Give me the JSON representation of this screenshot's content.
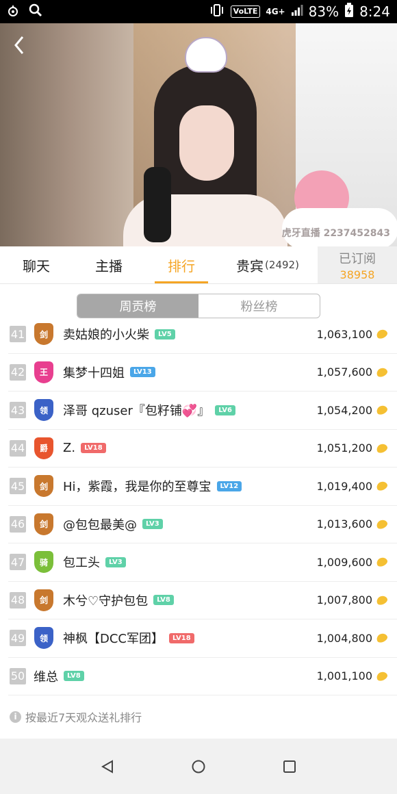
{
  "status_bar": {
    "volte": "VoLTE",
    "network": "4G+",
    "battery": "83%",
    "time": "8:24"
  },
  "video": {
    "watermark": "虎牙直播 2237452843"
  },
  "tabs": [
    {
      "label": "聊天"
    },
    {
      "label": "主播"
    },
    {
      "label": "排行",
      "active": true
    },
    {
      "label": "贵宾",
      "count": "(2492)"
    }
  ],
  "subscribe": {
    "label": "已订阅",
    "count": "38958"
  },
  "segment": {
    "weekly": "周贡榜",
    "fans": "粉丝榜",
    "active": "weekly"
  },
  "ranking": [
    {
      "rank": "41",
      "badge": "剑",
      "badge_color": "#c8782e",
      "name": "卖姑娘的小火柴",
      "level": "LV5",
      "level_color": "#5fd1a8",
      "score": "1,063,100"
    },
    {
      "rank": "42",
      "badge": "王",
      "badge_color": "#e83f8f",
      "name": "集梦十四姐",
      "level": "LV13",
      "level_color": "#4aa6e8",
      "score": "1,057,600"
    },
    {
      "rank": "43",
      "badge": "领",
      "badge_color": "#3b62c7",
      "name": "泽哥 qzuser『包籽铺💞』",
      "level": "LV6",
      "level_color": "#5fd1a8",
      "score": "1,054,200"
    },
    {
      "rank": "44",
      "badge": "爵",
      "badge_color": "#e8552e",
      "name": "Z.",
      "level": "LV18",
      "level_color": "#f06a6a",
      "score": "1,051,200"
    },
    {
      "rank": "45",
      "badge": "剑",
      "badge_color": "#c8782e",
      "name": "Hi，紫霞，我是你的至尊宝",
      "level": "LV12",
      "level_color": "#4aa6e8",
      "score": "1,019,400"
    },
    {
      "rank": "46",
      "badge": "剑",
      "badge_color": "#c8782e",
      "name": "@包包最美@",
      "level": "LV3",
      "level_color": "#5fd1a8",
      "score": "1,013,600"
    },
    {
      "rank": "47",
      "badge": "骑",
      "badge_color": "#7bbf3a",
      "name": "包工头",
      "level": "LV3",
      "level_color": "#5fd1a8",
      "score": "1,009,600"
    },
    {
      "rank": "48",
      "badge": "剑",
      "badge_color": "#c8782e",
      "name": "木兮♡守护包包",
      "level": "LV8",
      "level_color": "#5fd1a8",
      "score": "1,007,800"
    },
    {
      "rank": "49",
      "badge": "领",
      "badge_color": "#3b62c7",
      "name": "神枫【DCC军团】",
      "level": "LV18",
      "level_color": "#f06a6a",
      "score": "1,004,800"
    },
    {
      "rank": "50",
      "badge": "",
      "badge_color": "",
      "name": "维总",
      "level": "LV8",
      "level_color": "#5fd1a8",
      "score": "1,001,100"
    }
  ],
  "footnote": "按最近7天观众送礼排行"
}
